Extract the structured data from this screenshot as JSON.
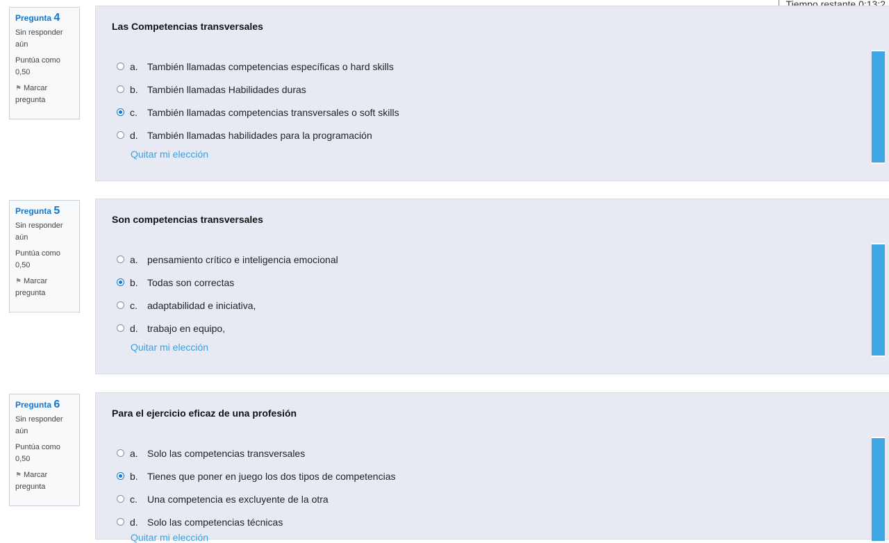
{
  "timer": {
    "text": "Tiempo restante 0:13:2"
  },
  "questions": [
    {
      "label": "Pregunta",
      "number": "4",
      "state": "Sin responder aún",
      "grade": "Puntúa como 0,50",
      "flag": "Marcar pregunta",
      "text": "Las Competencias transversales",
      "options": [
        {
          "letter": "a.",
          "text": "También llamadas competencias específicas o hard skills",
          "checked": false
        },
        {
          "letter": "b.",
          "text": "También llamadas Habilidades duras",
          "checked": false
        },
        {
          "letter": "c.",
          "text": "También llamadas competencias transversales o soft skills",
          "checked": true
        },
        {
          "letter": "d.",
          "text": "También llamadas habilidades para la programación",
          "checked": false
        }
      ],
      "clear": "Quitar mi elección"
    },
    {
      "label": "Pregunta",
      "number": "5",
      "state": "Sin responder aún",
      "grade": "Puntúa como 0,50",
      "flag": "Marcar pregunta",
      "text": "Son competencias transversales",
      "options": [
        {
          "letter": "a.",
          "text": "pensamiento crítico e inteligencia emocional",
          "checked": false
        },
        {
          "letter": "b.",
          "text": "Todas son correctas",
          "checked": true
        },
        {
          "letter": "c.",
          "text": "adaptabilidad e iniciativa,",
          "checked": false
        },
        {
          "letter": "d.",
          "text": "trabajo en equipo,",
          "checked": false
        }
      ],
      "clear": "Quitar mi elección"
    },
    {
      "label": "Pregunta",
      "number": "6",
      "state": "Sin responder aún",
      "grade": "Puntúa como 0,50",
      "flag": "Marcar pregunta",
      "text": "Para el ejercicio eficaz de una profesión",
      "options": [
        {
          "letter": "a.",
          "text": "Solo las competencias transversales",
          "checked": false
        },
        {
          "letter": "b.",
          "text": "Tienes que poner en juego los dos tipos de competencias",
          "checked": true
        },
        {
          "letter": "c.",
          "text": "Una competencia es excluyente de la otra",
          "checked": false
        },
        {
          "letter": "d.",
          "text": "Solo las competencias técnicas",
          "checked": false
        }
      ],
      "clear": "Quitar mi elección"
    }
  ]
}
